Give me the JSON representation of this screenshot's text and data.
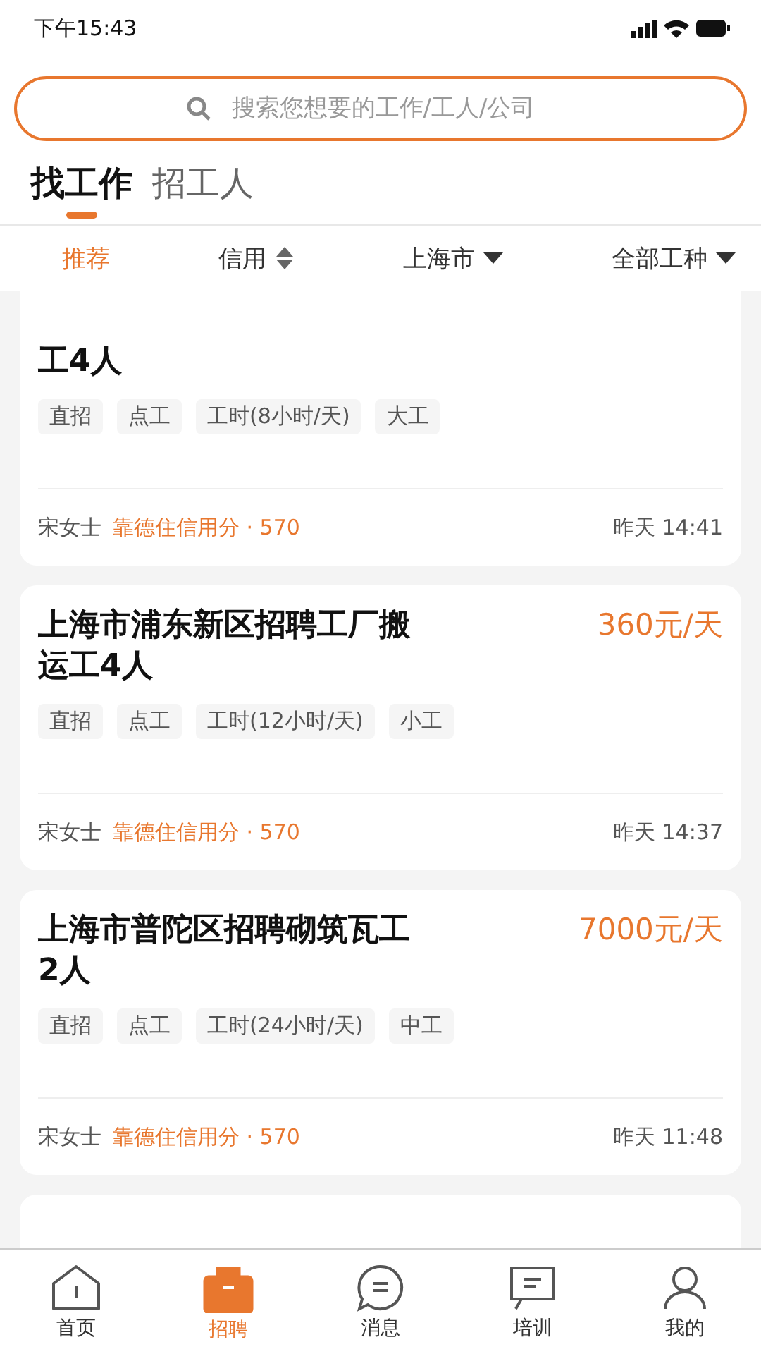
{
  "status_bar": {
    "time": "下午15:43"
  },
  "search": {
    "placeholder": "搜索您想要的工作/工人/公司"
  },
  "tabs": [
    {
      "label": "找工作",
      "selected": true
    },
    {
      "label": "招工人",
      "selected": false
    }
  ],
  "filters": [
    {
      "label": "推荐",
      "kind": "plain",
      "selected": true
    },
    {
      "label": "信用",
      "kind": "sort",
      "selected": false
    },
    {
      "label": "上海市",
      "kind": "dropdown",
      "selected": false
    },
    {
      "label": "全部工种",
      "kind": "dropdown",
      "selected": false
    }
  ],
  "jobs": [
    {
      "title": "工4人",
      "tags": [
        "直招",
        "点工",
        "工时(8小时/天)",
        "大工"
      ],
      "contact": "宋女士",
      "credit": "靠德住信用分 · 570",
      "time": "昨天 14:41"
    },
    {
      "title": "上海市浦东新区招聘工厂搬运工4人",
      "pay": "360元/天",
      "tags": [
        "直招",
        "点工",
        "工时(12小时/天)",
        "小工"
      ],
      "contact": "宋女士",
      "credit": "靠德住信用分 · 570",
      "time": "昨天 14:37"
    },
    {
      "title": "上海市普陀区招聘砌筑瓦工2人",
      "pay": "7000元/天",
      "tags": [
        "直招",
        "点工",
        "工时(24小时/天)",
        "中工"
      ],
      "contact": "宋女士",
      "credit": "靠德住信用分 · 570",
      "time": "昨天 11:48"
    }
  ],
  "nav": [
    {
      "label": "首页",
      "kind": "home",
      "selected": false
    },
    {
      "label": "招聘",
      "kind": "jobs",
      "selected": true
    },
    {
      "label": "消息",
      "kind": "chat",
      "selected": false
    },
    {
      "label": "培训",
      "kind": "training",
      "selected": false
    },
    {
      "label": "我的",
      "kind": "me",
      "selected": false
    }
  ]
}
